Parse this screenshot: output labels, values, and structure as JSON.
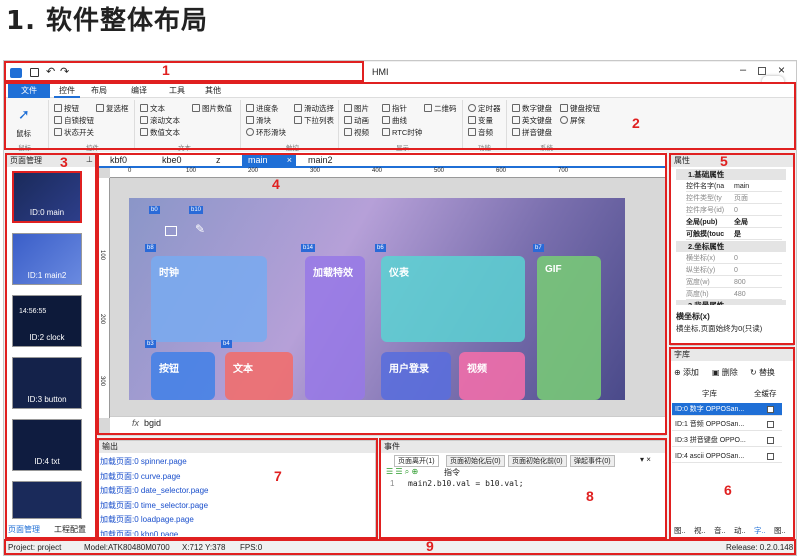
{
  "heading": "1. 软件整体布局",
  "window_title": "HMI",
  "annotations": [
    "1",
    "2",
    "3",
    "4",
    "5",
    "6",
    "7",
    "8",
    "9"
  ],
  "menu": [
    "文件",
    "控件",
    "布局",
    "编译",
    "工具",
    "其他"
  ],
  "ribbon": {
    "mouse": "鼠标",
    "controls": [
      "按钮",
      "复选框",
      "自锁按钮",
      "状态开关",
      "文本",
      "图片数值",
      "滚动文本",
      "数值文本",
      "进度条",
      "滑动选择",
      "滑块",
      "下拉列表",
      "环形滑块",
      "图片",
      "指针",
      "二维码",
      "动画",
      "曲线",
      "视频",
      "RTC时钟",
      "定时器",
      "数字键盘",
      "键盘按钮",
      "变量",
      "英文键盘",
      "屏保",
      "音频",
      "拼音键盘"
    ],
    "groups": [
      "鼠标",
      "控件",
      "文本",
      "触控",
      "显示",
      "功能",
      "系统"
    ]
  },
  "page_mgr": {
    "title": "页面管理",
    "pages": [
      "ID:0 main",
      "ID:1 main2",
      "ID:2 clock",
      "ID:3 button",
      "ID:4 txt"
    ],
    "clock_text": "14:56:55",
    "bottom_tabs": [
      "页面管理",
      "工程配置"
    ]
  },
  "editor": {
    "tabs": [
      "kbf0",
      "kbe0",
      "z",
      "main",
      "main2"
    ],
    "close": "×",
    "ruler": [
      "0",
      "100",
      "200",
      "300",
      "400",
      "500",
      "600",
      "700"
    ],
    "vruler": [
      "100",
      "200",
      "300"
    ],
    "badges": [
      "b0",
      "b10",
      "b8",
      "b14",
      "b6",
      "b7",
      "b3",
      "b4"
    ],
    "cards": [
      "时钟",
      "加载特效",
      "仪表",
      "GIF",
      "按钮",
      "文本",
      "用户登录",
      "视频"
    ],
    "bottom_label": "bgid",
    "fx": "fx"
  },
  "props": {
    "title": "属性",
    "sections": [
      "1.基础属性",
      "2.坐标属性",
      "3.背景属性"
    ],
    "rows": [
      [
        "控件名字(na",
        "main"
      ],
      [
        "控件类型(ty",
        "页面"
      ],
      [
        "控件序号(id)",
        "0"
      ],
      [
        "全局(pub)",
        "全局"
      ],
      [
        "可触摸(touc",
        "是"
      ],
      [
        "横坐标(x)",
        "0"
      ],
      [
        "纵坐标(y)",
        "0"
      ],
      [
        "宽度(w)",
        "800"
      ],
      [
        "高度(h)",
        "480"
      ]
    ],
    "desc_title": "横坐标(x)",
    "desc_text": "横坐标,页面始终为0(只读)"
  },
  "fonts": {
    "title": "字库",
    "actions": [
      "添加",
      "删除",
      "替换"
    ],
    "headers": [
      "字库",
      "全缓存"
    ],
    "rows": [
      "ID:0 数字 OPPOSan...",
      "ID:1 音频 OPPOSan...",
      "ID:3 拼音键盘 OPPO...",
      "ID:4 ascii OPPOSan..."
    ],
    "tabs": [
      "图..",
      "视..",
      "音..",
      "动..",
      "字..",
      "图.."
    ]
  },
  "output": {
    "title": "输出",
    "lines": [
      "加载页面:0 spinner.page",
      "加载页面:0 curve.page",
      "加载页面:0 date_selector.page",
      "加载页面:0 time_selector.page",
      "加载页面:0 loadpage.page",
      "加载页面:0 kbn0.page"
    ]
  },
  "events": {
    "title": "事件",
    "tabs": [
      "页面离开(1)",
      "页面初始化后(0)",
      "页面初始化前(0)",
      "弹起事件(0)"
    ],
    "toolbar_label": "指令",
    "line_no": "1",
    "code": "main2.b10.val =  b10.val;"
  },
  "status": {
    "project": "Project:  project",
    "model": "Model:ATK80480M0700",
    "xy": "X:712 Y:378",
    "fps": "FPS:0",
    "release": "Release: 0.2.0.148"
  },
  "colors": {
    "accent": "#1f6fd6",
    "annotation": "#e02020"
  }
}
